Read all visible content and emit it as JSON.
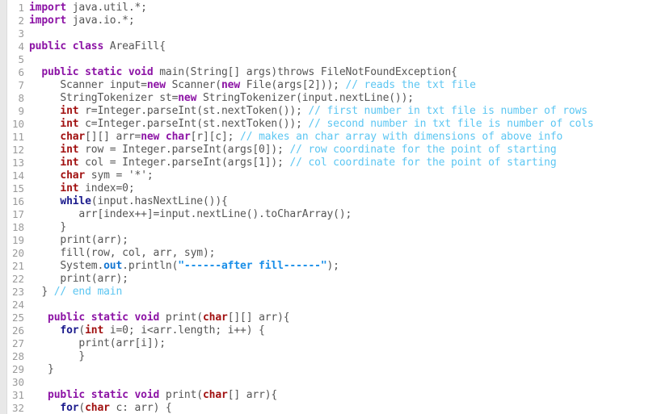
{
  "editor": {
    "language": "java",
    "class_name": "AreaFill",
    "colors": {
      "background": "#ffffff",
      "gutter": "#e8e8e8",
      "line_number": "#9a9a9a",
      "plain_text": "#555555",
      "modifier_keyword": "#8c13a5",
      "type_keyword": "#a11111",
      "control_keyword": "#1a1a8c",
      "field_keyword": "#1476d2",
      "string_literal": "#1a8fe8",
      "comment": "#5cc6f2"
    },
    "first_line": 1,
    "last_line": 32
  },
  "lines": [
    {
      "n": "1",
      "tokens": [
        {
          "t": "import",
          "c": "k-mod"
        },
        {
          "t": " java.util.*;",
          "c": "plain"
        }
      ]
    },
    {
      "n": "2",
      "tokens": [
        {
          "t": "import",
          "c": "k-mod"
        },
        {
          "t": " java.io.*;",
          "c": "plain"
        }
      ]
    },
    {
      "n": "3",
      "tokens": []
    },
    {
      "n": "4",
      "tokens": [
        {
          "t": "public class",
          "c": "k-mod"
        },
        {
          "t": " AreaFill{",
          "c": "plain"
        }
      ]
    },
    {
      "n": "5",
      "tokens": []
    },
    {
      "n": "6",
      "tokens": [
        {
          "t": "  ",
          "c": "plain"
        },
        {
          "t": "public static void",
          "c": "k-mod"
        },
        {
          "t": " main(String[] args)throws FileNotFoundException{",
          "c": "plain"
        }
      ]
    },
    {
      "n": "7",
      "tokens": [
        {
          "t": "     Scanner input=",
          "c": "plain"
        },
        {
          "t": "new",
          "c": "k-mod"
        },
        {
          "t": " Scanner(",
          "c": "plain"
        },
        {
          "t": "new",
          "c": "k-mod"
        },
        {
          "t": " File(args[2])); ",
          "c": "plain"
        },
        {
          "t": "// reads the txt file",
          "c": "cmt"
        }
      ]
    },
    {
      "n": "8",
      "tokens": [
        {
          "t": "     StringTokenizer st=",
          "c": "plain"
        },
        {
          "t": "new",
          "c": "k-mod"
        },
        {
          "t": " StringTokenizer(input.nextLine());",
          "c": "plain"
        }
      ]
    },
    {
      "n": "9",
      "tokens": [
        {
          "t": "     ",
          "c": "plain"
        },
        {
          "t": "int",
          "c": "k-type"
        },
        {
          "t": " r=Integer.parseInt(st.nextToken()); ",
          "c": "plain"
        },
        {
          "t": "// first number in txt file is number of rows",
          "c": "cmt"
        }
      ]
    },
    {
      "n": "10",
      "tokens": [
        {
          "t": "     ",
          "c": "plain"
        },
        {
          "t": "int",
          "c": "k-type"
        },
        {
          "t": " c=Integer.parseInt(st.nextToken()); ",
          "c": "plain"
        },
        {
          "t": "// second number in txt file is number of cols",
          "c": "cmt"
        }
      ]
    },
    {
      "n": "11",
      "tokens": [
        {
          "t": "     ",
          "c": "plain"
        },
        {
          "t": "char",
          "c": "k-type"
        },
        {
          "t": "[][] arr=",
          "c": "plain"
        },
        {
          "t": "new char",
          "c": "k-mod"
        },
        {
          "t": "[r][c]; ",
          "c": "plain"
        },
        {
          "t": "// makes an char array with dimensions of above info",
          "c": "cmt"
        }
      ]
    },
    {
      "n": "12",
      "tokens": [
        {
          "t": "     ",
          "c": "plain"
        },
        {
          "t": "int",
          "c": "k-type"
        },
        {
          "t": " row = Integer.parseInt(args[0]); ",
          "c": "plain"
        },
        {
          "t": "// row coordinate for the point of starting",
          "c": "cmt"
        }
      ]
    },
    {
      "n": "13",
      "tokens": [
        {
          "t": "     ",
          "c": "plain"
        },
        {
          "t": "int",
          "c": "k-type"
        },
        {
          "t": " col = Integer.parseInt(args[1]); ",
          "c": "plain"
        },
        {
          "t": "// col coordinate for the point of starting",
          "c": "cmt"
        }
      ]
    },
    {
      "n": "14",
      "tokens": [
        {
          "t": "     ",
          "c": "plain"
        },
        {
          "t": "char",
          "c": "k-type"
        },
        {
          "t": " sym = '*';",
          "c": "plain"
        }
      ]
    },
    {
      "n": "15",
      "tokens": [
        {
          "t": "     ",
          "c": "plain"
        },
        {
          "t": "int",
          "c": "k-type"
        },
        {
          "t": " index=0;",
          "c": "plain"
        }
      ]
    },
    {
      "n": "16",
      "tokens": [
        {
          "t": "     ",
          "c": "plain"
        },
        {
          "t": "while",
          "c": "k-ctrl"
        },
        {
          "t": "(input.hasNextLine()){",
          "c": "plain"
        }
      ]
    },
    {
      "n": "17",
      "tokens": [
        {
          "t": "        arr[index++]=input.nextLine().toCharArray();",
          "c": "plain"
        }
      ]
    },
    {
      "n": "18",
      "tokens": [
        {
          "t": "     }",
          "c": "plain"
        }
      ]
    },
    {
      "n": "19",
      "tokens": [
        {
          "t": "     print(arr);",
          "c": "plain"
        }
      ]
    },
    {
      "n": "20",
      "tokens": [
        {
          "t": "     fill(row, col, arr, sym);",
          "c": "plain"
        }
      ]
    },
    {
      "n": "21",
      "tokens": [
        {
          "t": "     System.",
          "c": "plain"
        },
        {
          "t": "out",
          "c": "k-field"
        },
        {
          "t": ".println(",
          "c": "plain"
        },
        {
          "t": "\"------after fill------\"",
          "c": "str"
        },
        {
          "t": ");",
          "c": "plain"
        }
      ]
    },
    {
      "n": "22",
      "tokens": [
        {
          "t": "     print(arr);",
          "c": "plain"
        }
      ]
    },
    {
      "n": "23",
      "tokens": [
        {
          "t": "  } ",
          "c": "plain"
        },
        {
          "t": "// end main",
          "c": "cmt"
        }
      ]
    },
    {
      "n": "24",
      "tokens": []
    },
    {
      "n": "25",
      "tokens": [
        {
          "t": "   ",
          "c": "plain"
        },
        {
          "t": "public static void",
          "c": "k-mod"
        },
        {
          "t": " print(",
          "c": "plain"
        },
        {
          "t": "char",
          "c": "k-type"
        },
        {
          "t": "[][] arr){",
          "c": "plain"
        }
      ]
    },
    {
      "n": "26",
      "tokens": [
        {
          "t": "     ",
          "c": "plain"
        },
        {
          "t": "for",
          "c": "k-ctrl"
        },
        {
          "t": "(",
          "c": "plain"
        },
        {
          "t": "int",
          "c": "k-type"
        },
        {
          "t": " i=0; i<arr.length; i++) {",
          "c": "plain"
        }
      ]
    },
    {
      "n": "27",
      "tokens": [
        {
          "t": "        print(arr[i]);",
          "c": "plain"
        }
      ]
    },
    {
      "n": "28",
      "tokens": [
        {
          "t": "        }",
          "c": "plain"
        }
      ]
    },
    {
      "n": "29",
      "tokens": [
        {
          "t": "   }",
          "c": "plain"
        }
      ]
    },
    {
      "n": "30",
      "tokens": []
    },
    {
      "n": "31",
      "tokens": [
        {
          "t": "   ",
          "c": "plain"
        },
        {
          "t": "public static void",
          "c": "k-mod"
        },
        {
          "t": " print(",
          "c": "plain"
        },
        {
          "t": "char",
          "c": "k-type"
        },
        {
          "t": "[] arr){",
          "c": "plain"
        }
      ]
    },
    {
      "n": "32",
      "tokens": [
        {
          "t": "     ",
          "c": "plain"
        },
        {
          "t": "for",
          "c": "k-ctrl"
        },
        {
          "t": "(",
          "c": "plain"
        },
        {
          "t": "char",
          "c": "k-type"
        },
        {
          "t": " c: arr) {",
          "c": "plain"
        }
      ]
    }
  ]
}
